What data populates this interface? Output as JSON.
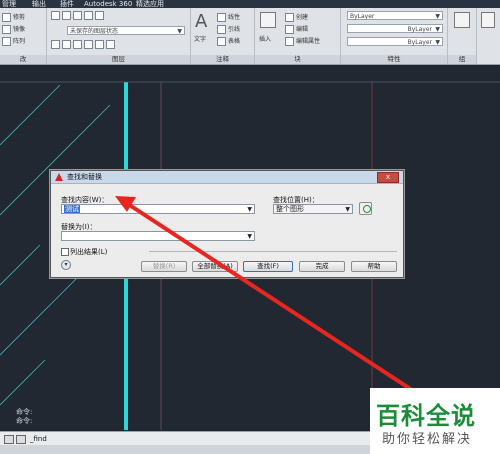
{
  "menubar": {
    "items": [
      "管理",
      "输出",
      "插件",
      "Autodesk 360",
      "精选应用"
    ]
  },
  "ribbon": {
    "row1": [
      "修剪",
      "镜像",
      "阵列"
    ],
    "layer_state": "未保存的图层状态",
    "panel_labels": [
      "改",
      "图层",
      "注释",
      "块",
      "特性",
      "组"
    ],
    "text_label": "文字",
    "annotation_items": [
      "线性",
      "引线",
      "表格"
    ],
    "insert_label": "插入",
    "block_items": [
      "创建",
      "编辑",
      "编辑属性"
    ],
    "properties": [
      "ByLayer",
      "ByLayer",
      "ByLayer"
    ],
    "group_label": "组"
  },
  "dialog": {
    "title": "查找和替换",
    "close_label": "x",
    "find_label": "查找内容(W)：",
    "find_value": "测试",
    "where_label": "查找位置(H)：",
    "where_value": "整个图形",
    "replace_label": "替换为(I)：",
    "replace_value": "",
    "list_results_label": "列出结果(L)",
    "buttons": {
      "replace": "替换(R)",
      "replace_all": "全部替换(A)",
      "find": "查找(F)",
      "done": "完成",
      "help": "帮助"
    }
  },
  "command": {
    "history": [
      "命令:",
      "命令:"
    ],
    "input": "_find"
  },
  "watermark": {
    "title": "百科全说",
    "subtitle": "助你轻松解决"
  },
  "colors": {
    "drawing_bg": "#212832",
    "cyan_line": "#31d6d9",
    "arrow_red": "#e8261f",
    "watermark_green": "#1d8c3a"
  }
}
